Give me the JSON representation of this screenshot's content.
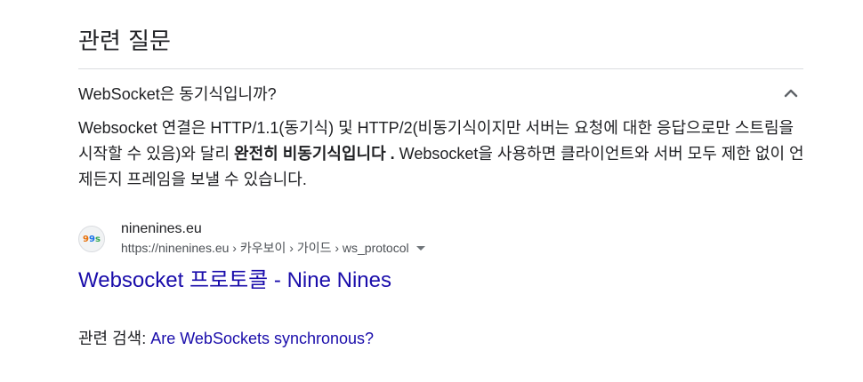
{
  "section": {
    "title": "관련 질문"
  },
  "question": {
    "text": "WebSocket은 동기식입니까?",
    "toggle_icon": "chevron-up-icon"
  },
  "answer": {
    "part1": "Websocket 연결은 HTTP/1.1(동기식) 및 HTTP/2(비동기식이지만 서버는 요청에 대한 응답으로만 스트림을 시작할 수 있음)와 달리 ",
    "bold": "완전히 비동기식입니다 .",
    "part2": " Websocket을 사용하면 클라이언트와 서버 모두 제한 없이 언제든지 프레임을 보낼 수 있습니다."
  },
  "source": {
    "favicon_text": [
      "9",
      "9",
      "s"
    ],
    "site_name": "ninenines.eu",
    "url": "https://ninenines.eu › 카우보이 › 가이드 › ws_protocol",
    "title": "Websocket 프로토콜 - Nine Nines"
  },
  "related_search": {
    "label": "관련 검색: ",
    "link": "Are WebSockets synchronous?"
  },
  "colors": {
    "link": "#1a0dab",
    "text": "#202124",
    "secondary_text": "#4d5156",
    "divider": "#dadce0"
  }
}
